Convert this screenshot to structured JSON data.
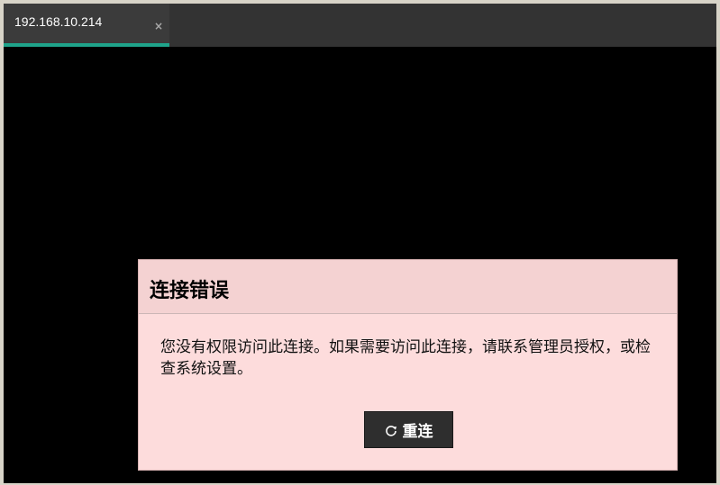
{
  "tab": {
    "title": "192.168.10.214",
    "close_icon": "close-icon",
    "close_glyph": "×",
    "active_underline_color": "#1fa48b"
  },
  "dialog": {
    "title": "连接错误",
    "message": "您没有权限访问此连接。如果需要访问此连接，请联系管理员授权，或检查系统设置。",
    "button_label": "重连",
    "button_icon": "refresh-icon",
    "background_color": "#fddcdc"
  }
}
